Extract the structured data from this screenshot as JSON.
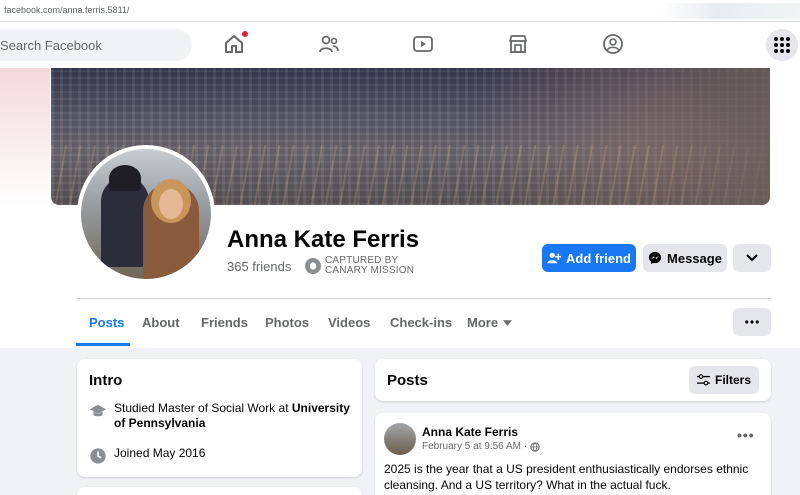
{
  "browser": {
    "url": "facebook.com/anna.ferris.5811/"
  },
  "topnav": {
    "search_placeholder": "Search Facebook"
  },
  "profile": {
    "name": "Anna Kate Ferris",
    "friends": "365 friends",
    "captured_line1": "CAPTURED BY",
    "captured_line2": "CANARY MISSION"
  },
  "actions": {
    "add_friend": "Add friend",
    "message": "Message"
  },
  "tabs": [
    "Posts",
    "About",
    "Friends",
    "Photos",
    "Videos",
    "Check-ins",
    "More"
  ],
  "intro": {
    "title": "Intro",
    "education_prefix": "Studied Master of Social Work at ",
    "education_school": "University of Pennsylvania",
    "joined": "Joined May 2016"
  },
  "posts": {
    "title": "Posts",
    "filters": "Filters",
    "items": [
      {
        "author": "Anna Kate Ferris",
        "date": "February 5 at 9:56 AM",
        "text": "2025 is the year that a US president enthusiastically endorses ethnic cleansing. And a US territory? What in the actual fuck."
      }
    ]
  },
  "colors": {
    "brand": "#1877f2",
    "notification": "#e41e3f"
  }
}
